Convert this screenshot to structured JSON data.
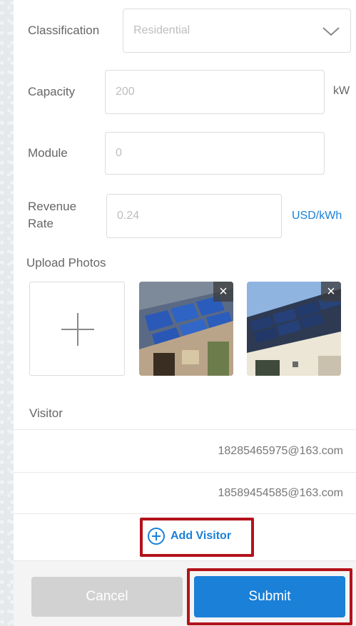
{
  "form": {
    "classification_label": "Classification",
    "classification_value": "Residential",
    "capacity_label": "Capacity",
    "capacity_value": "200",
    "capacity_unit": "kW",
    "module_label": "Module",
    "module_value": "0",
    "revenue_label_line1": "Revenue",
    "revenue_label_line2": "Rate",
    "revenue_value": "0.24",
    "revenue_unit": "USD/kWh",
    "upload_label": "Upload Photos"
  },
  "photos": {
    "close_glyph": "×",
    "add_icon": "plus-icon"
  },
  "visitors": {
    "title": "Visitor",
    "emails": [
      "18285465975@163.com",
      "18589454585@163.com"
    ],
    "add_label": "Add Visitor"
  },
  "actions": {
    "cancel_label": "Cancel",
    "submit_label": "Submit"
  },
  "colors": {
    "accent": "#1a80d8",
    "highlight": "#b3121b",
    "cancel_bg": "#d2d2d2"
  }
}
